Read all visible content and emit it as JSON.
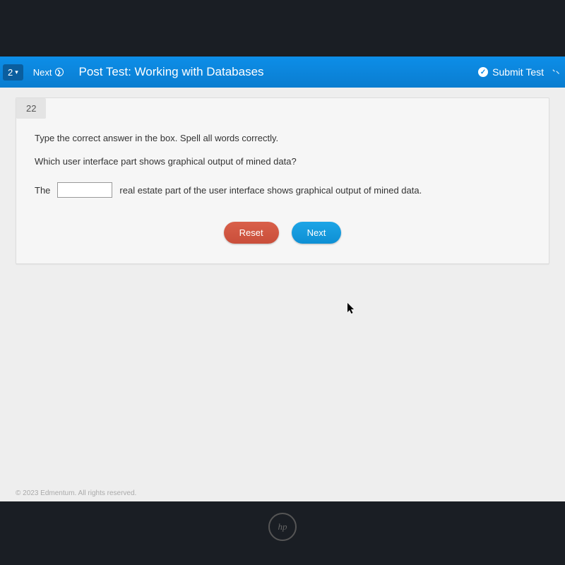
{
  "header": {
    "page_badge": "2",
    "next_label": "Next",
    "title": "Post Test: Working with Databases",
    "submit_label": "Submit Test"
  },
  "question": {
    "number": "22",
    "instruction": "Type the correct answer in the box. Spell all words correctly.",
    "prompt": "Which user interface part shows graphical output of mined data?",
    "sentence_start": "The",
    "blank_value": "",
    "sentence_end": "real estate part of the user interface shows graphical output of mined data."
  },
  "buttons": {
    "reset": "Reset",
    "next": "Next"
  },
  "footer": {
    "copyright": "© 2023 Edmentum. All rights reserved."
  },
  "laptop": {
    "brand": "hp"
  }
}
